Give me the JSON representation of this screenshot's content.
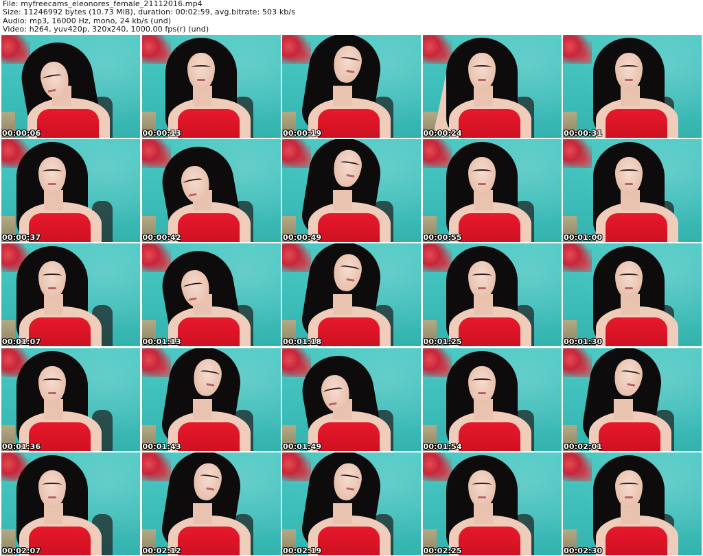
{
  "header": {
    "line1": "File: myfreecams_eleonores_female_21112016.mp4",
    "line2": "Size: 11246992 bytes (10.73 MiB), duration: 00:02:59, avg.bitrate: 503 kb/s",
    "line3": "Audio: mp3, 16000 Hz, mono, 24 kb/s (und)",
    "line4": "Video: h264, yuv420p, 320x240, 1000.00 fps(r) (und)"
  },
  "thumbnails": [
    {
      "time": "00:00:06",
      "pose": "tilt-l"
    },
    {
      "time": "00:00:13",
      "pose": ""
    },
    {
      "time": "00:00:19",
      "pose": "tilt-r"
    },
    {
      "time": "00:00:24",
      "pose": "arm"
    },
    {
      "time": "00:00:31",
      "pose": "shift-r"
    },
    {
      "time": "00:00:37",
      "pose": "shift-l"
    },
    {
      "time": "00:00:42",
      "pose": "tilt-l"
    },
    {
      "time": "00:00:49",
      "pose": "tilt-r"
    },
    {
      "time": "00:00:55",
      "pose": ""
    },
    {
      "time": "00:01:00",
      "pose": "shift-r"
    },
    {
      "time": "00:01:07",
      "pose": "shift-l"
    },
    {
      "time": "00:01:13",
      "pose": "tilt-l"
    },
    {
      "time": "00:01:18",
      "pose": "tilt-r"
    },
    {
      "time": "00:01:25",
      "pose": ""
    },
    {
      "time": "00:01:30",
      "pose": "shift-r"
    },
    {
      "time": "00:01:36",
      "pose": "shift-l"
    },
    {
      "time": "00:01:43",
      "pose": "tilt-r"
    },
    {
      "time": "00:01:49",
      "pose": "tilt-l"
    },
    {
      "time": "00:01:54",
      "pose": ""
    },
    {
      "time": "00:02:01",
      "pose": "tilt-r"
    },
    {
      "time": "00:02:07",
      "pose": "shift-l"
    },
    {
      "time": "00:02:12",
      "pose": "tilt-r"
    },
    {
      "time": "00:02:19",
      "pose": "tilt-r"
    },
    {
      "time": "00:02:25",
      "pose": ""
    },
    {
      "time": "00:02:30",
      "pose": "shift-r"
    }
  ],
  "colors": {
    "wall": "#42c2be",
    "top": "#e3192b",
    "hair": "#0d0b0b",
    "timestamp_text": "#ffffff"
  }
}
